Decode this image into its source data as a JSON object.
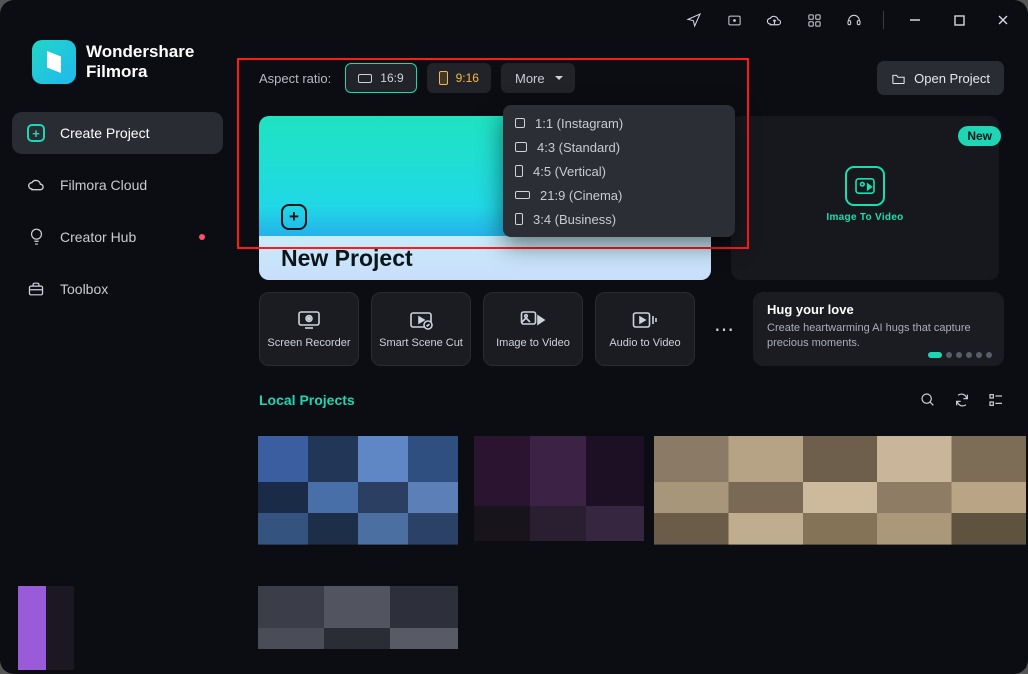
{
  "brand": {
    "line1": "Wondershare",
    "line2": "Filmora"
  },
  "nav": {
    "create": "Create Project",
    "cloud": "Filmora Cloud",
    "hub": "Creator Hub",
    "toolbox": "Toolbox"
  },
  "aspect": {
    "label": "Aspect ratio:",
    "r169": "16:9",
    "r916": "9:16",
    "more": "More",
    "options": {
      "o1": "1:1 (Instagram)",
      "o2": "4:3 (Standard)",
      "o3": "4:5 (Vertical)",
      "o4": "21:9 (Cinema)",
      "o5": "3:4 (Business)"
    }
  },
  "open_project": "Open Project",
  "new_project": "New Project",
  "promo": {
    "badge": "New",
    "icon_cap": "Image To Video",
    "title": "Hug your love",
    "desc": "Create heartwarming AI hugs that capture precious moments."
  },
  "tools": {
    "t1": "Screen Recorder",
    "t2": "Smart Scene Cut",
    "t3": "Image to Video",
    "t4": "Audio to Video"
  },
  "local_projects": "Local Projects"
}
